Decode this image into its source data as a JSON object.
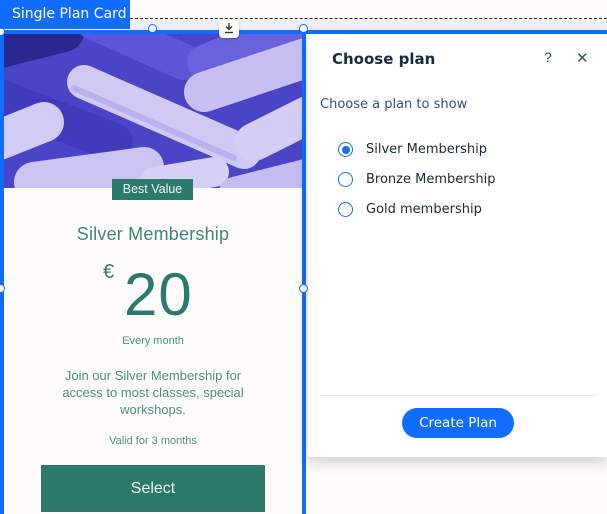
{
  "selection": {
    "label": "Single Plan Card",
    "download_icon": "download-icon"
  },
  "card": {
    "badge": "Best Value",
    "plan_name": "Silver Membership",
    "currency": "€",
    "price": "20",
    "frequency": "Every month",
    "description": "Join our Silver Membership for access to most classes, special workshops.",
    "validity": "Valid for 3 months",
    "button_label": "Select",
    "colors": {
      "accent": "#2b7a6c",
      "text": "#4f8e80"
    }
  },
  "panel": {
    "title": "Choose plan",
    "help_label": "?",
    "close_label": "✕",
    "subtitle": "Choose a plan to show",
    "options": [
      {
        "label": "Silver Membership",
        "selected": true
      },
      {
        "label": "Bronze Membership",
        "selected": false
      },
      {
        "label": "Gold membership",
        "selected": false
      }
    ],
    "create_button_label": "Create Plan",
    "colors": {
      "primary": "#116dff",
      "title": "#162d3d"
    }
  }
}
